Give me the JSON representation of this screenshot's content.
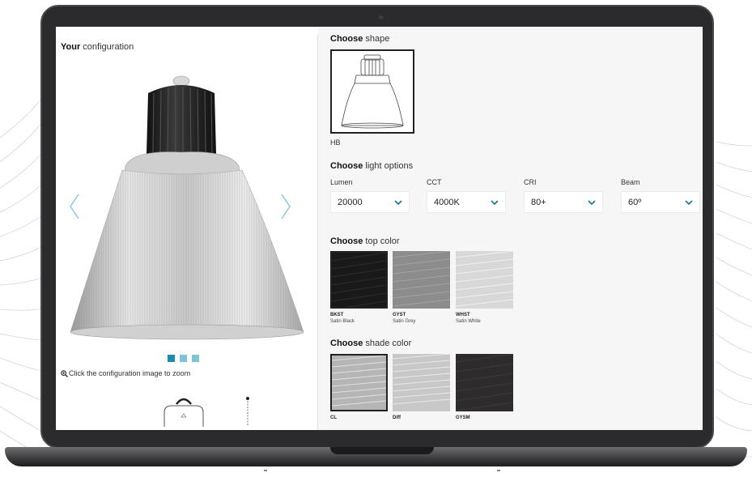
{
  "left_panel": {
    "title_bold": "Your",
    "title_rest": " configuration",
    "zoom_hint": "Click the configuration image to zoom",
    "carousel": {
      "slides": 3,
      "active": 1
    }
  },
  "right_panel": {
    "shape": {
      "heading_bold": "Choose",
      "heading_rest": " shape",
      "selected_label": "HB"
    },
    "light_options": {
      "heading_bold": "Choose",
      "heading_rest": " light options",
      "lumen": {
        "label": "Lumen",
        "value": "20000"
      },
      "cct": {
        "label": "CCT",
        "value": "4000K"
      },
      "cri": {
        "label": "CRI",
        "value": "80+"
      },
      "beam": {
        "label": "Beam",
        "value": "60º"
      }
    },
    "top_color": {
      "heading_bold": "Choose",
      "heading_rest": " top color",
      "swatches": [
        {
          "code": "BKST",
          "name": "Satin Black",
          "color": "#1a1a1a"
        },
        {
          "code": "GYST",
          "name": "Satin Grey",
          "color": "#8c8c8c"
        },
        {
          "code": "WHST",
          "name": "Satin White",
          "color": "#d8d8d8"
        }
      ]
    },
    "shade_color": {
      "heading_bold": "Choose",
      "heading_rest": " shade color",
      "swatches": [
        {
          "code": "CL",
          "color": "#b5b5b5"
        },
        {
          "code": "Diff",
          "color": "#c8c8c8"
        },
        {
          "code": "GYSM",
          "color": "#2e2b2d"
        }
      ]
    }
  },
  "colors": {
    "accent": "#1a8cb0",
    "accent_light": "#7ec3d8",
    "arrow": "#7fc4e0",
    "laptop_frame": "#2b2b2d"
  }
}
